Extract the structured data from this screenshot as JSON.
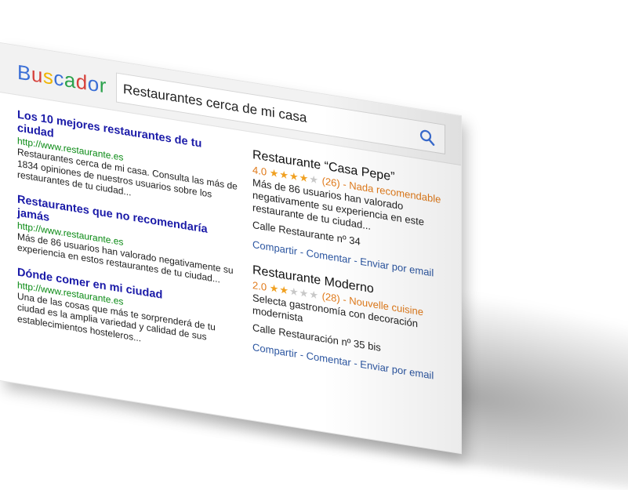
{
  "app": {
    "logo_letters": [
      {
        "ch": "B",
        "color": "#3b6fd6"
      },
      {
        "ch": "u",
        "color": "#d6403a"
      },
      {
        "ch": "s",
        "color": "#f0b400"
      },
      {
        "ch": "c",
        "color": "#3b6fd6"
      },
      {
        "ch": "a",
        "color": "#2ba24c"
      },
      {
        "ch": "d",
        "color": "#d6403a"
      },
      {
        "ch": "o",
        "color": "#3b6fd6"
      },
      {
        "ch": "r",
        "color": "#2ba24c"
      }
    ]
  },
  "search": {
    "value": "Restaurantes cerca de mi casa",
    "icon": "search-icon"
  },
  "results": [
    {
      "title": "Los 10 mejores restaurantes de tu ciudad",
      "url": "http://www.restaurante.es",
      "snippet": "Restaurantes cerca de mi casa. Consulta las más de 1834 opiniones de nuestros usuarios sobre los restaurantes de tu ciudad..."
    },
    {
      "title": "Restaurantes que no recomendaría jamás",
      "url": "http://www.restaurante.es",
      "snippet": "Más de 86 usuarios han valorado negativamente su experiencia en estos restaurantes de tu ciudad..."
    },
    {
      "title": "Dónde comer en mi ciudad",
      "url": "http://www.restaurante.es",
      "snippet": "Una de las cosas que más te sorprenderá de tu ciudad es la amplia variedad y calidad de sus establecimientos hosteleros..."
    }
  ],
  "places": [
    {
      "name": "Restaurante “Casa Pepe”",
      "rating": "4.0",
      "stars_filled": 4,
      "stars_total": 5,
      "reviews": "(26) - Nada recomendable",
      "description": "Más de 86 usuarios han valorado negativamente su experiencia en este restaurante de tu ciudad...",
      "address": "Calle Restaurante nº 34",
      "actions": [
        "Compartir",
        "Comentar",
        "Enviar por email"
      ]
    },
    {
      "name": "Restaurante Moderno",
      "rating": "2.0",
      "stars_filled": 2,
      "stars_total": 5,
      "reviews": "(28) - Nouvelle cuisine",
      "description": "Selecta gastronomía con decoración modernista",
      "address": "Calle Restauración nº 35 bis",
      "actions": [
        "Compartir",
        "Comentar",
        "Enviar por email"
      ]
    }
  ],
  "colors": {
    "title_link": "#1a1aa8",
    "url": "#0a8a14",
    "rating": "#e07a1a",
    "action_link": "#2b55a0"
  },
  "separator": " - "
}
